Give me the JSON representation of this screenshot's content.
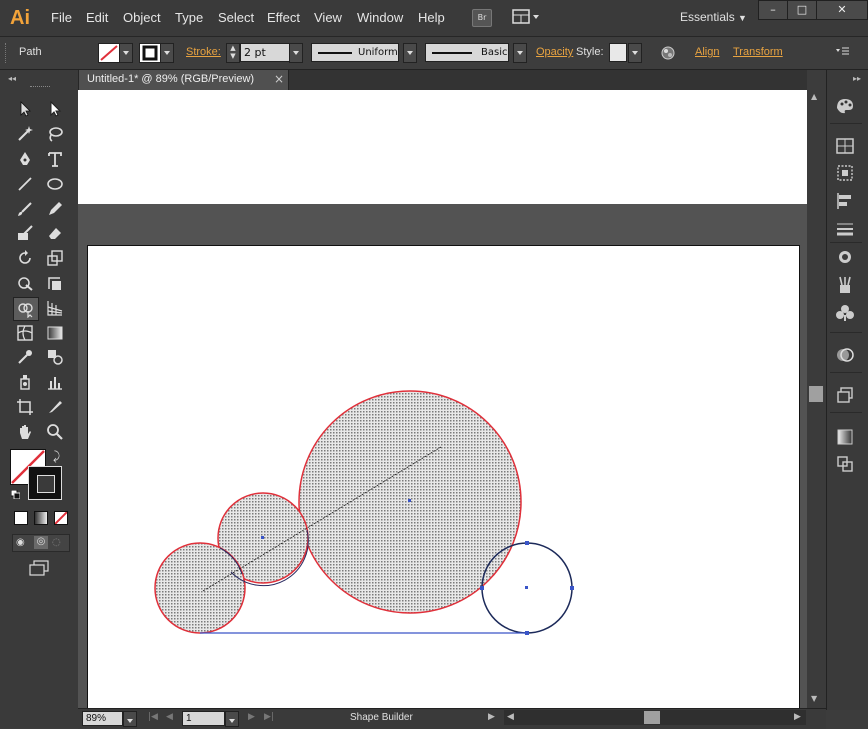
{
  "app": {
    "logo": "Ai"
  },
  "menu": [
    "File",
    "Edit",
    "Object",
    "Type",
    "Select",
    "Effect",
    "View",
    "Window",
    "Help"
  ],
  "bridge_label": "Br",
  "workspace": "Essentials",
  "window_controls": {
    "minimize": "–",
    "restore": "□",
    "close": "✕"
  },
  "control_bar": {
    "selection": "Path",
    "stroke_label": "Stroke:",
    "stroke_weight": "2 pt",
    "profile": "Uniform",
    "brush": "Basic",
    "opacity_label": "Opacity",
    "style_label": "Style:",
    "align_label": "Align",
    "transform_label": "Transform"
  },
  "document_tab": {
    "title": "Untitled-1* @ 89% (RGB/Preview)",
    "close": "×"
  },
  "status_bar": {
    "zoom": "89%",
    "artboard": "1",
    "tool": "Shape Builder"
  },
  "colors": {
    "path_red": "#e0303a",
    "selection_blue": "#3a55c8",
    "fill_pattern": "#888888",
    "accent_orange": "#e8a341"
  },
  "tools": [
    "selection-icon",
    "direct-selection-icon",
    "magic-wand-icon",
    "lasso-icon",
    "pen-icon",
    "type-icon",
    "line-icon",
    "ellipse-icon",
    "paintbrush-icon",
    "pencil-icon",
    "blob-brush-icon",
    "eraser-icon",
    "rotate-icon",
    "scale-icon",
    "warp-icon",
    "free-transform-icon",
    "shape-builder-icon",
    "perspective-grid-icon",
    "mesh-icon",
    "gradient-icon",
    "eyedropper-icon",
    "blend-icon",
    "symbol-sprayer-icon",
    "column-graph-icon",
    "artboard-icon",
    "slice-icon",
    "hand-icon",
    "zoom-icon"
  ],
  "dock_icons": [
    "color-icon",
    "swatches-icon",
    "symbols-icon",
    "align-panel-icon",
    "stroke-panel-icon",
    "appearance-icon",
    "brushes-icon",
    "symbols-club-icon",
    "transparency-icon",
    "layers-icon",
    "gradient-panel-icon",
    "artboards-icon"
  ]
}
